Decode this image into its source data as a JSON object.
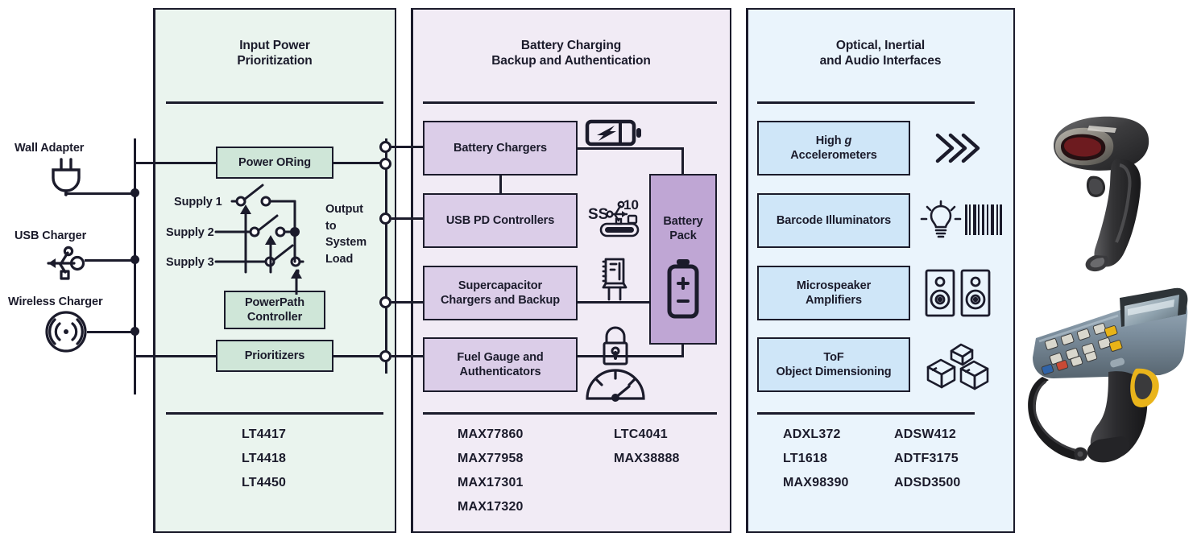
{
  "diagram": {
    "inputs": [
      {
        "label": "Wall Adapter",
        "icon": "power-plug-icon"
      },
      {
        "label": "USB Charger",
        "icon": "usb-icon"
      },
      {
        "label": "Wireless Charger",
        "icon": "wireless-charging-icon"
      }
    ]
  },
  "panels": {
    "input_power": {
      "title_line1": "Input Power",
      "title_line2": "Prioritization",
      "blocks": [
        {
          "label": "Power ORing"
        },
        {
          "label_line1": "PowerPath",
          "label_line2": "Controller"
        },
        {
          "label": "Prioritizers"
        }
      ],
      "supplies": [
        "Supply 1",
        "Supply 2",
        "Supply 3"
      ],
      "output_label": "Output\nto\nSystem\nLoad",
      "parts": [
        "LT4417",
        "LT4418",
        "LT4450"
      ]
    },
    "battery_charging": {
      "title_line1": "Battery Charging",
      "title_line2": "Backup and Authentication",
      "blocks": [
        {
          "label": "Battery Chargers",
          "icon": "battery-charging-icon"
        },
        {
          "label": "USB PD Controllers",
          "icon": "usb-superspeed-10-icon"
        },
        {
          "label_line1": "Supercapacitor",
          "label_line2": "Chargers and Backup",
          "icon": "capacitor-icon"
        },
        {
          "label_line1": "Fuel Gauge and",
          "label_line2": "Authenticators",
          "icon": "lock-icon",
          "icon2": "gauge-icon"
        }
      ],
      "battery_pack": {
        "label_line1": "Battery",
        "label_line2": "Pack",
        "icon": "battery-cell-icon",
        "plus": "+",
        "minus": "–"
      },
      "parts_col1": [
        "MAX77860",
        "MAX77958",
        "MAX17301",
        "MAX17320"
      ],
      "parts_col2": [
        "LTC4041",
        "MAX38888"
      ]
    },
    "optical_inertial_audio": {
      "title_line1": "Optical, Inertial",
      "title_line2": "and Audio Interfaces",
      "blocks": [
        {
          "label_line1": "High g",
          "label_line2": "Accelerometers",
          "icon": "chevrons-icon"
        },
        {
          "label": "Barcode Illuminators",
          "icon": "bulb-barcode-icon"
        },
        {
          "label_line1": "Microspeaker",
          "label_line2": "Amplifiers",
          "icon": "speakers-icon"
        },
        {
          "label_line1": "ToF",
          "label_line2": "Object Dimensioning",
          "icon": "boxes-icon"
        }
      ],
      "parts_col1": [
        "ADXL372",
        "LT1618",
        "MAX98390"
      ],
      "parts_col2": [
        "ADSW412",
        "ADTF3175",
        "ADSD3500"
      ]
    }
  },
  "photos": [
    {
      "name": "handheld-barcode-scanner-photo"
    },
    {
      "name": "rugged-mobile-computer-photo"
    }
  ],
  "colors": {
    "ink": "#1b1b2b",
    "panel_green": "#eaf4ee",
    "panel_purple": "#f1ebf5",
    "panel_blue": "#eaf4fc",
    "block_green": "#cfe6d8",
    "block_purple": "#dbcde8",
    "block_blue": "#cfe6f8",
    "battery_purple": "#bfa6d4"
  }
}
